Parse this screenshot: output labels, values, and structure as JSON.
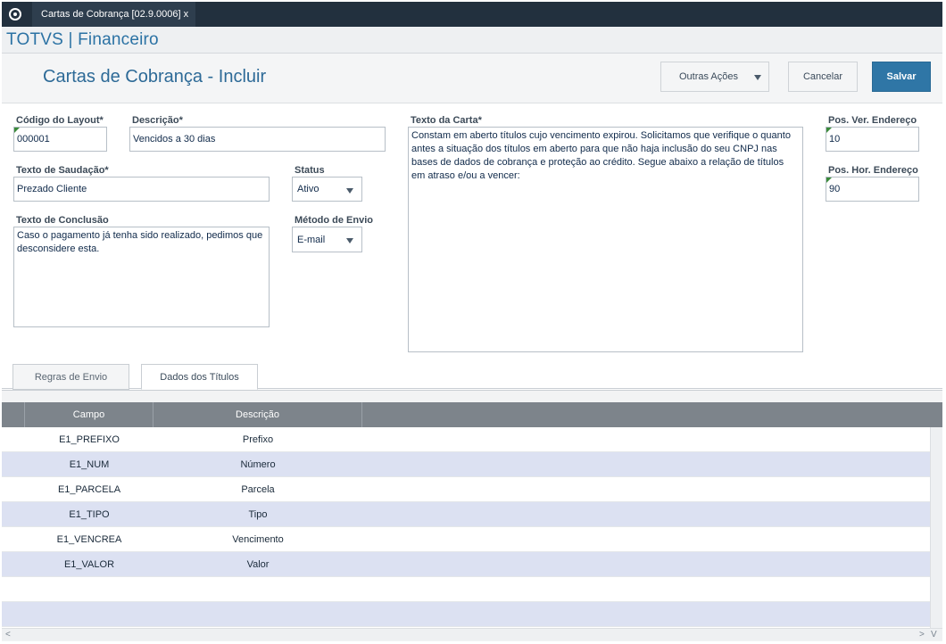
{
  "window": {
    "tab_title": "Cartas de Cobrança [02.9.0006] x"
  },
  "brand": "TOTVS | Financeiro",
  "header": {
    "title": "Cartas de Cobrança - Incluir",
    "outras_acoes": "Outras Ações",
    "cancelar": "Cancelar",
    "salvar": "Salvar"
  },
  "form": {
    "codigo_layout": {
      "label": "Código do Layout*",
      "value": "000001"
    },
    "descricao": {
      "label": "Descrição*",
      "value": "Vencidos a 30 dias"
    },
    "texto_saudacao": {
      "label": "Texto de Saudação*",
      "value": "Prezado Cliente"
    },
    "status": {
      "label": "Status",
      "value": "Ativo"
    },
    "texto_conclusao": {
      "label": "Texto de Conclusão",
      "value": "Caso o pagamento já tenha sido realizado, pedimos que desconsidere esta."
    },
    "metodo_envio": {
      "label": "Método de Envio",
      "value": "E-mail"
    },
    "texto_carta": {
      "label": "Texto da Carta*",
      "value": "Constam em aberto títulos cujo vencimento expirou. Solicitamos que verifique o quanto antes a situação dos títulos em aberto para que não haja inclusão do seu CNPJ nas bases de dados de cobrança e proteção ao crédito. Segue abaixo a relação de títulos em atraso e/ou a vencer:"
    },
    "pos_ver": {
      "label": "Pos. Ver. Endereço",
      "value": "10"
    },
    "pos_hor": {
      "label": "Pos. Hor. Endereço",
      "value": "90"
    }
  },
  "tabs": [
    {
      "label": "Regras de Envio"
    },
    {
      "label": "Dados dos Títulos"
    }
  ],
  "grid": {
    "columns": [
      "Campo",
      "Descrição"
    ],
    "rows": [
      {
        "campo": "E1_PREFIXO",
        "descricao": "Prefixo"
      },
      {
        "campo": "E1_NUM",
        "descricao": "Número"
      },
      {
        "campo": "E1_PARCELA",
        "descricao": "Parcela"
      },
      {
        "campo": "E1_TIPO",
        "descricao": "Tipo"
      },
      {
        "campo": "E1_VENCREA",
        "descricao": "Vencimento"
      },
      {
        "campo": "E1_VALOR",
        "descricao": "Valor"
      }
    ],
    "scroll": {
      "left": "<",
      "right": ">",
      "down": "V"
    }
  }
}
